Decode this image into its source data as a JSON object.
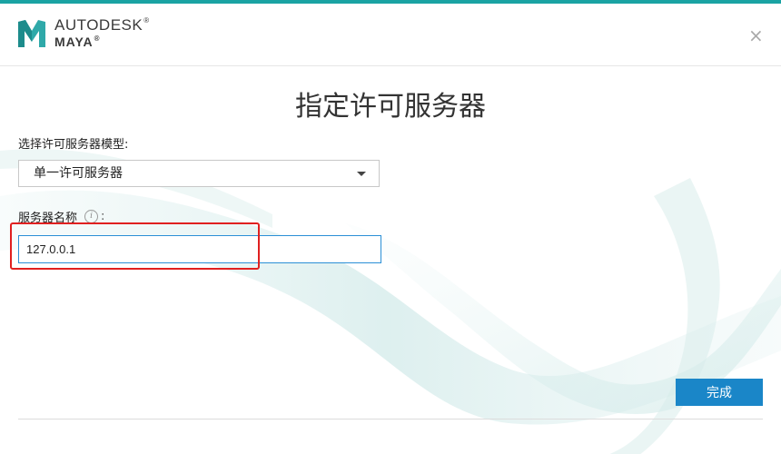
{
  "header": {
    "brand_line1": "AUTODESK",
    "brand_line2": "MAYA",
    "close_symbol": "×"
  },
  "page": {
    "title": "指定许可服务器"
  },
  "form": {
    "model_label": "选择许可服务器模型:",
    "model_selected": "单一许可服务器",
    "name_label": "服务器名称",
    "name_value": "127.0.0.1"
  },
  "footer": {
    "done_label": "完成"
  },
  "icons": {
    "logo": "maya-logo-icon",
    "close": "close-icon",
    "info": "info-icon",
    "dropdown": "chevron-down-icon"
  },
  "colors": {
    "accent_top": "#1aa3a3",
    "button": "#1a86c8",
    "input_focus": "#2b8fd6",
    "highlight": "#e02020"
  }
}
